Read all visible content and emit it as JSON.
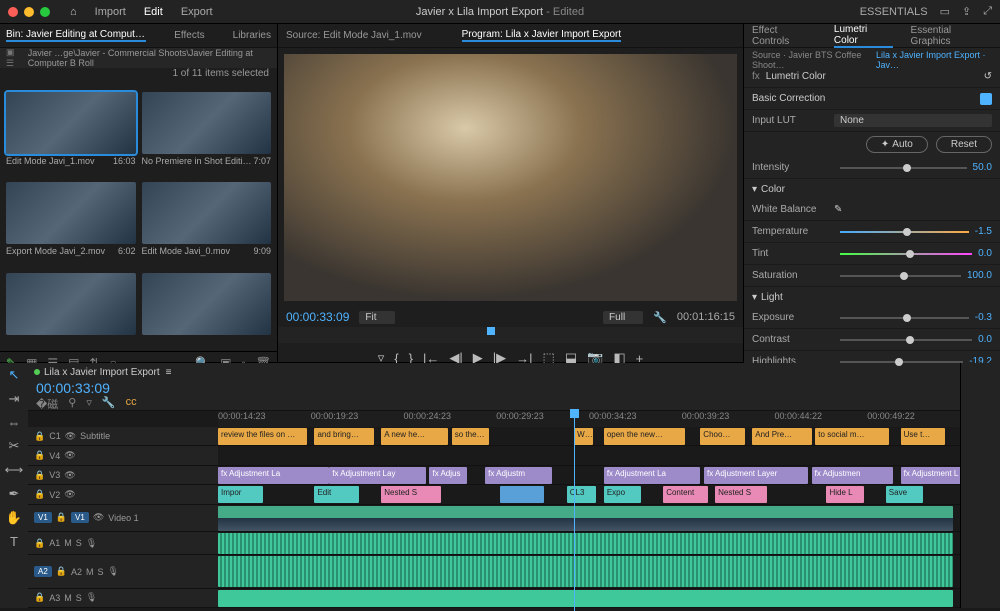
{
  "topbar": {
    "menu": [
      "Import",
      "Edit",
      "Export"
    ],
    "active_menu": "Edit",
    "title": "Javier x Lila Import Export",
    "title_suffix": "- Edited",
    "workspace": "ESSENTIALS"
  },
  "project": {
    "tabs": [
      "Bin: Javier Editing at Computer B Roll",
      "Effects",
      "Libraries"
    ],
    "active_tab": 0,
    "breadcrumb": "Javier …ge\\Javier - Commercial Shoots\\Javier Editing at Computer B Roll",
    "selection": "1 of 11 items selected",
    "clips": [
      {
        "name": "Edit Mode Javi_1.mov",
        "dur": "16:03",
        "selected": true
      },
      {
        "name": "No Premiere in Shot Editi…",
        "dur": "7:07"
      },
      {
        "name": "Export Mode Javi_2.mov",
        "dur": "6:02"
      },
      {
        "name": "Edit Mode Javi_0.mov",
        "dur": "9:09"
      }
    ]
  },
  "monitor": {
    "source_tab": "Source: Edit Mode Javi_1.mov",
    "program_tab": "Program: Lila x Javier Import Export",
    "tc_left": "00:00:33:09",
    "fit": "Fit",
    "full": "Full",
    "tc_right": "00:01:16:15"
  },
  "lumetri": {
    "tabs": [
      "Effect Controls",
      "Lumetri Color",
      "Essential Graphics"
    ],
    "active_tab": 1,
    "source": "Source · Javier BTS Coffee Shoot…",
    "seq_link": "Lila x Javier Import Export · Jav…",
    "fx_label": "Lumetri Color",
    "sections": {
      "basic": "Basic Correction",
      "input_lut": "Input LUT",
      "lut_value": "None",
      "auto": "Auto",
      "reset": "Reset",
      "intensity": "Intensity",
      "intensity_val": "50.0",
      "color": "Color",
      "wb": "White Balance",
      "temp": "Temperature",
      "temp_val": "-1.5",
      "tint": "Tint",
      "tint_val": "0.0",
      "sat": "Saturation",
      "sat_val": "100.0",
      "light": "Light",
      "exposure": "Exposure",
      "exposure_val": "-0.3",
      "contrast": "Contrast",
      "contrast_val": "0.0",
      "highlights": "Highlights",
      "highlights_val": "-19.2"
    }
  },
  "timeline": {
    "seq_name": "Lila x Javier Import Export",
    "tc": "00:00:33:09",
    "ruler": [
      "00:00:14:23",
      "00:00:19:23",
      "00:00:24:23",
      "00:00:29:23",
      "00:00:34:23",
      "00:00:39:23",
      "00:00:44:22",
      "00:00:49:22"
    ],
    "tracks": {
      "c1": "Subtitle",
      "v1": "Video 1",
      "v1_tag": "V1",
      "a2_tag": "A2"
    },
    "captions": [
      {
        "l": 0,
        "w": 12,
        "t": "review the files on …"
      },
      {
        "l": 13,
        "w": 8,
        "t": "and bring…"
      },
      {
        "l": 22,
        "w": 9,
        "t": "A new he…"
      },
      {
        "l": 31.5,
        "w": 5,
        "t": "so the…"
      },
      {
        "l": 48,
        "w": 2.5,
        "t": "W…"
      },
      {
        "l": 52,
        "w": 11,
        "t": "open the new…"
      },
      {
        "l": 65,
        "w": 6,
        "t": "Choo…"
      },
      {
        "l": 72,
        "w": 8,
        "t": "And Pre…"
      },
      {
        "l": 80.5,
        "w": 10,
        "t": "to social m…"
      },
      {
        "l": 92,
        "w": 6,
        "t": "Use t…"
      }
    ],
    "adjustments": [
      {
        "l": 0,
        "w": 15,
        "t": "Adjustment La"
      },
      {
        "l": 15,
        "w": 13,
        "t": "Adjustment Lay"
      },
      {
        "l": 28.5,
        "w": 5,
        "t": "Adjus"
      },
      {
        "l": 36,
        "w": 9,
        "t": "Adjustm"
      },
      {
        "l": 52,
        "w": 13,
        "t": "Adjustment La"
      },
      {
        "l": 65.5,
        "w": 14,
        "t": "Adjustment Layer"
      },
      {
        "l": 80,
        "w": 11,
        "t": "Adjustmen"
      },
      {
        "l": 92,
        "w": 9,
        "t": "Adjustment L"
      }
    ],
    "nested": [
      {
        "l": 0,
        "w": 6,
        "c": "teal",
        "t": "Impor"
      },
      {
        "l": 13,
        "w": 6,
        "c": "teal",
        "t": "Edit"
      },
      {
        "l": 22,
        "w": 8,
        "c": "pink",
        "t": "Nested S"
      },
      {
        "l": 38,
        "w": 6,
        "c": "blue",
        "t": ""
      },
      {
        "l": 47,
        "w": 4,
        "c": "teal",
        "t": "CL3"
      },
      {
        "l": 52,
        "w": 5,
        "c": "teal",
        "t": "Expo"
      },
      {
        "l": 60,
        "w": 6,
        "c": "pink",
        "t": "Content"
      },
      {
        "l": 67,
        "w": 7,
        "c": "pink",
        "t": "Nested S"
      },
      {
        "l": 82,
        "w": 5,
        "c": "pink",
        "t": "Hide L"
      },
      {
        "l": 90,
        "w": 5,
        "c": "teal",
        "t": "Save"
      }
    ]
  }
}
